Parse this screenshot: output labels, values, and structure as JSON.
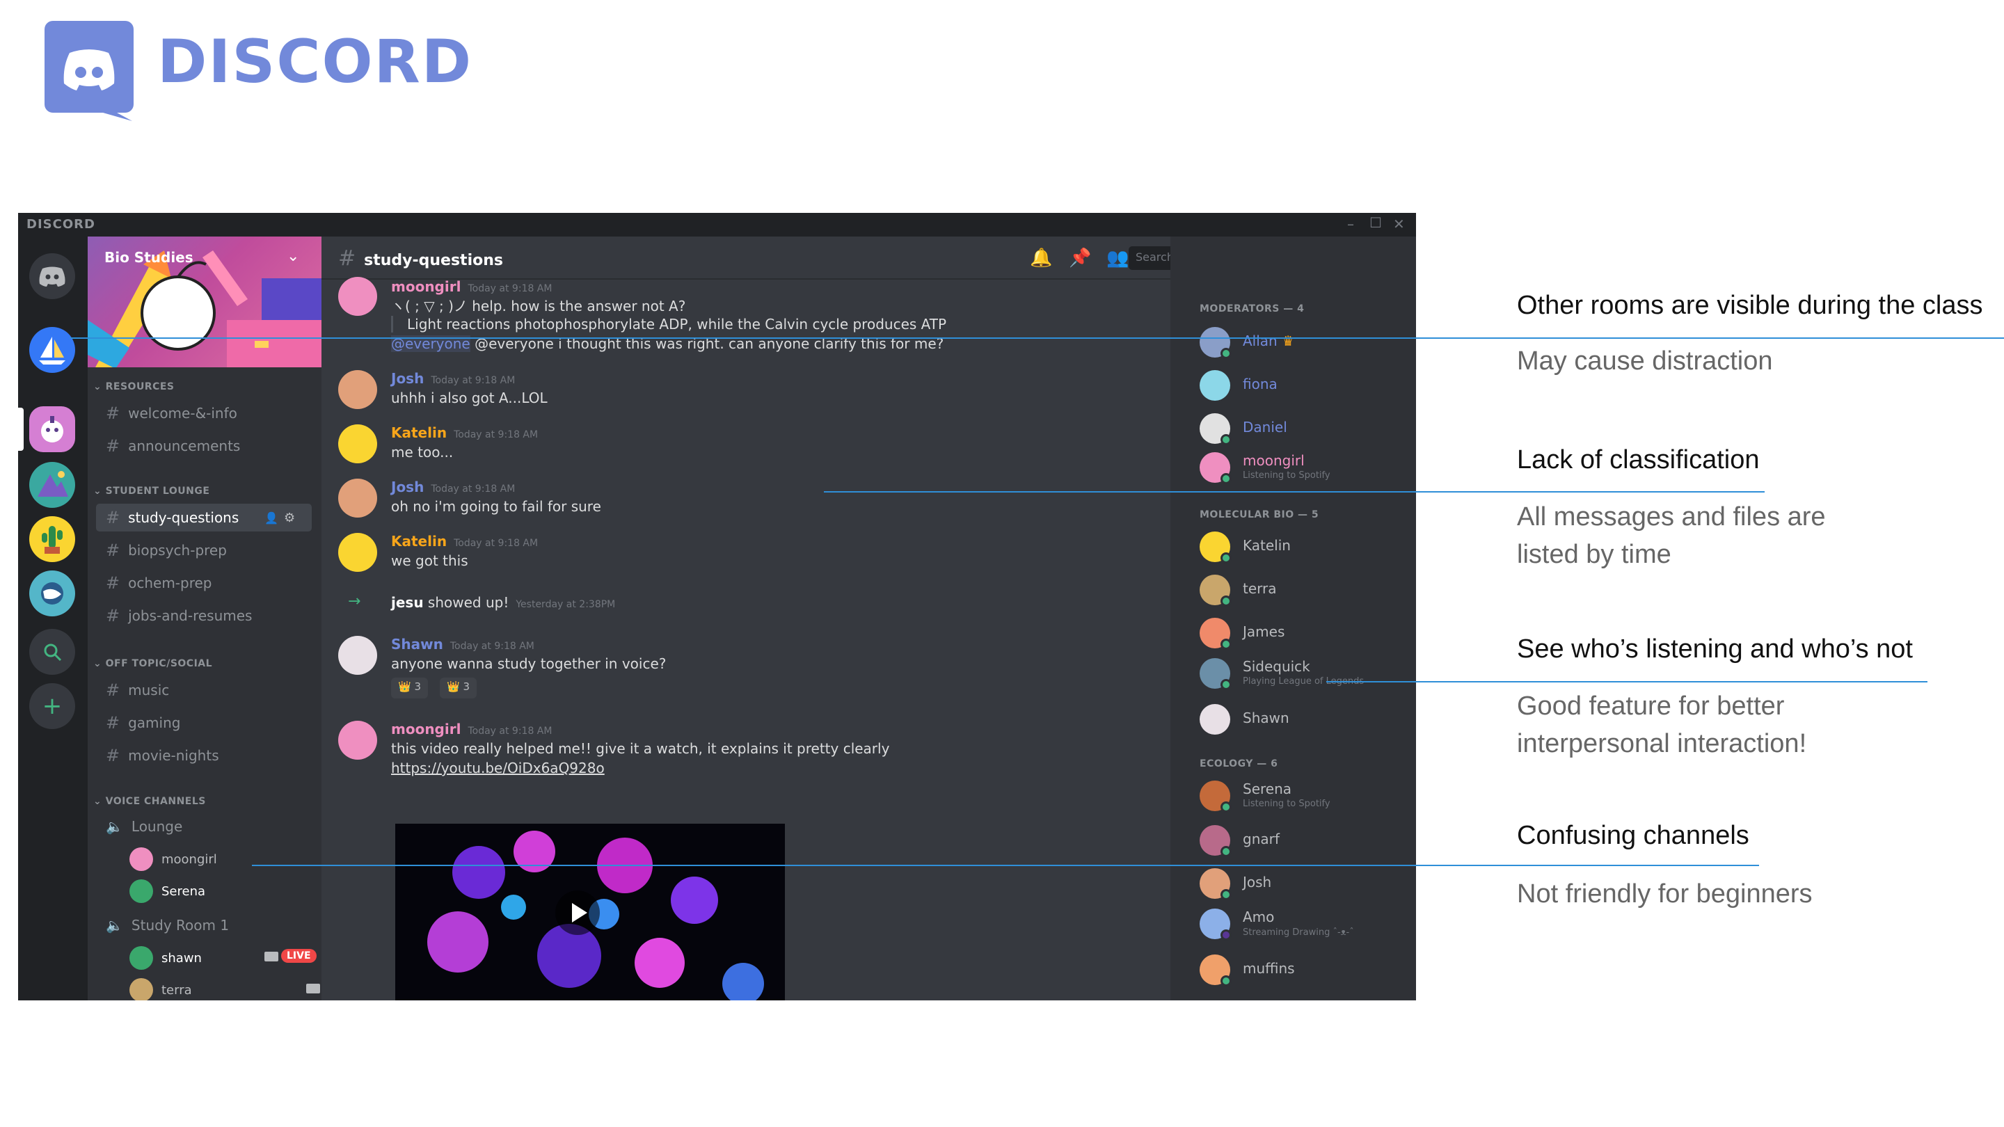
{
  "brand": {
    "wordmark": "DISCORD",
    "accent": "#7289da"
  },
  "app": {
    "titlebar_brand": "DISCORD",
    "server_name": "Bio Studies",
    "categories": {
      "resources": "RESOURCES",
      "student_lounge": "STUDENT LOUNGE",
      "off_topic": "OFF TOPIC/SOCIAL",
      "voice": "VOICE CHANNELS"
    },
    "channels": {
      "welcome": "welcome-&-info",
      "announcements": "announcements",
      "study_questions": "study-questions",
      "biopsych": "biopsych-prep",
      "ochem": "ochem-prep",
      "jobs": "jobs-and-resumes",
      "music": "music",
      "gaming": "gaming",
      "movie_nights": "movie-nights"
    },
    "voice": {
      "lounge": "Lounge",
      "lounge_users": [
        "moongirl",
        "Serena"
      ],
      "study_room": "Study Room 1",
      "study_users": [
        "shawn",
        "terra"
      ],
      "live_badge": "LIVE"
    },
    "chat": {
      "channel": "study-questions",
      "search_placeholder": "Search",
      "messages": [
        {
          "name": "moongirl",
          "time": "Today at 9:18 AM",
          "lines": [
            "ヽ( ; ▽ ; )ノ help. how is the answer not A?",
            "Light reactions photophosphorylate ADP, while the Calvin cycle produces ATP",
            "@everyone i thought this was right. can anyone clarify this for me?"
          ]
        },
        {
          "name": "Josh",
          "time": "Today at 9:18 AM",
          "lines": [
            "uhhh i also got A...LOL"
          ]
        },
        {
          "name": "Katelin",
          "time": "Today at 9:18 AM",
          "lines": [
            "me too..."
          ]
        },
        {
          "name": "Josh",
          "time": "Today at 9:18 AM",
          "lines": [
            "oh no i'm going to fail for sure"
          ]
        },
        {
          "name": "Katelin",
          "time": "Today at 9:18 AM",
          "lines": [
            "we got this"
          ]
        },
        {
          "name": "jesu",
          "time": "Yesterday at 2:38PM",
          "lines": [
            "showed up!"
          ]
        },
        {
          "name": "Shawn",
          "time": "Today at 9:18 AM",
          "lines": [
            "anyone wanna study together in voice?"
          ],
          "reactions": [
            "3",
            "3"
          ]
        },
        {
          "name": "moongirl",
          "time": "Today at 9:18 AM",
          "lines": [
            "this video really helped me!! give it a watch, it explains it pretty clearly",
            "https://youtu.be/OiDx6aQ928o"
          ]
        }
      ]
    },
    "members": {
      "groups": [
        {
          "title": "MODERATORS — 4",
          "users": [
            {
              "name": "Allan",
              "status": ""
            },
            {
              "name": "fiona",
              "status": ""
            },
            {
              "name": "Daniel",
              "status": ""
            },
            {
              "name": "moongirl",
              "status": "Listening to Spotify"
            }
          ]
        },
        {
          "title": "MOLECULAR BIO — 5",
          "users": [
            {
              "name": "Katelin",
              "status": ""
            },
            {
              "name": "terra",
              "status": ""
            },
            {
              "name": "James",
              "status": ""
            },
            {
              "name": "Sidequick",
              "status": "Playing League of Legends"
            },
            {
              "name": "Shawn",
              "status": ""
            }
          ]
        },
        {
          "title": "ECOLOGY — 6",
          "users": [
            {
              "name": "Serena",
              "status": "Listening to Spotify"
            },
            {
              "name": "gnarf",
              "status": ""
            },
            {
              "name": "Josh",
              "status": ""
            },
            {
              "name": "Amo",
              "status": "Streaming Drawing ˆ-ᴥ-ˆ"
            },
            {
              "name": "muffins",
              "status": ""
            }
          ]
        }
      ]
    }
  },
  "annotations": [
    {
      "title": "Other rooms are visible during the class",
      "body": [
        "May cause distraction"
      ]
    },
    {
      "title": "Lack of classification",
      "body": [
        "All messages and files are",
        "listed by time"
      ]
    },
    {
      "title": "See who’s listening and who’s not",
      "body": [
        "Good feature for better",
        "interpersonal interaction!"
      ]
    },
    {
      "title": "Confusing channels",
      "body": [
        "Not friendly for beginners"
      ]
    }
  ]
}
